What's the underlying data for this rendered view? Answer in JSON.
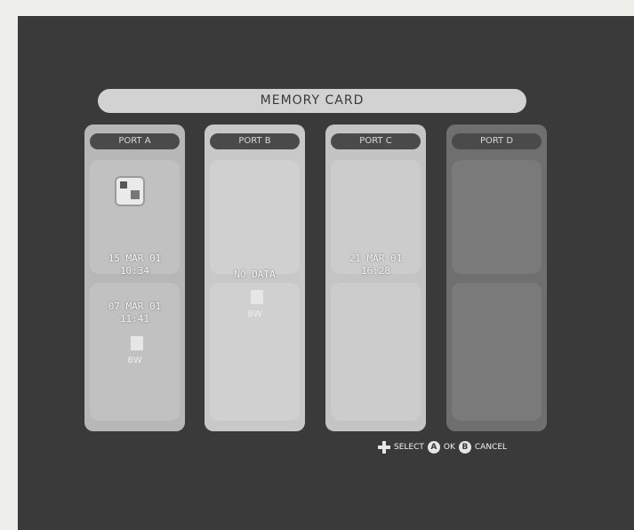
{
  "title": "MEMORY CARD",
  "columns": [
    {
      "header": "PORT A",
      "slots": [
        {
          "date": "15 MAR 01",
          "time": "10:34"
        },
        {
          "date": "07 MAR 01",
          "time": "11:41",
          "blocks": "8W"
        }
      ]
    },
    {
      "header": "PORT B",
      "slots": [
        {
          "date": "NO DATA",
          "blocks": "8W"
        }
      ]
    },
    {
      "header": "PORT C",
      "slots": [
        {
          "date": "21 MAR 01",
          "time": "16:28"
        }
      ]
    },
    {
      "header": "PORT D",
      "slots": []
    }
  ],
  "controls": {
    "select_label": "SELECT",
    "ok_label": "OK",
    "cancel_label": "CANCEL",
    "ok_button": "A",
    "cancel_button": "B"
  },
  "colors": {
    "background": "#3a3a3a",
    "title_bar": "#d2d2d2",
    "empty_port": "#6f6f6f"
  }
}
